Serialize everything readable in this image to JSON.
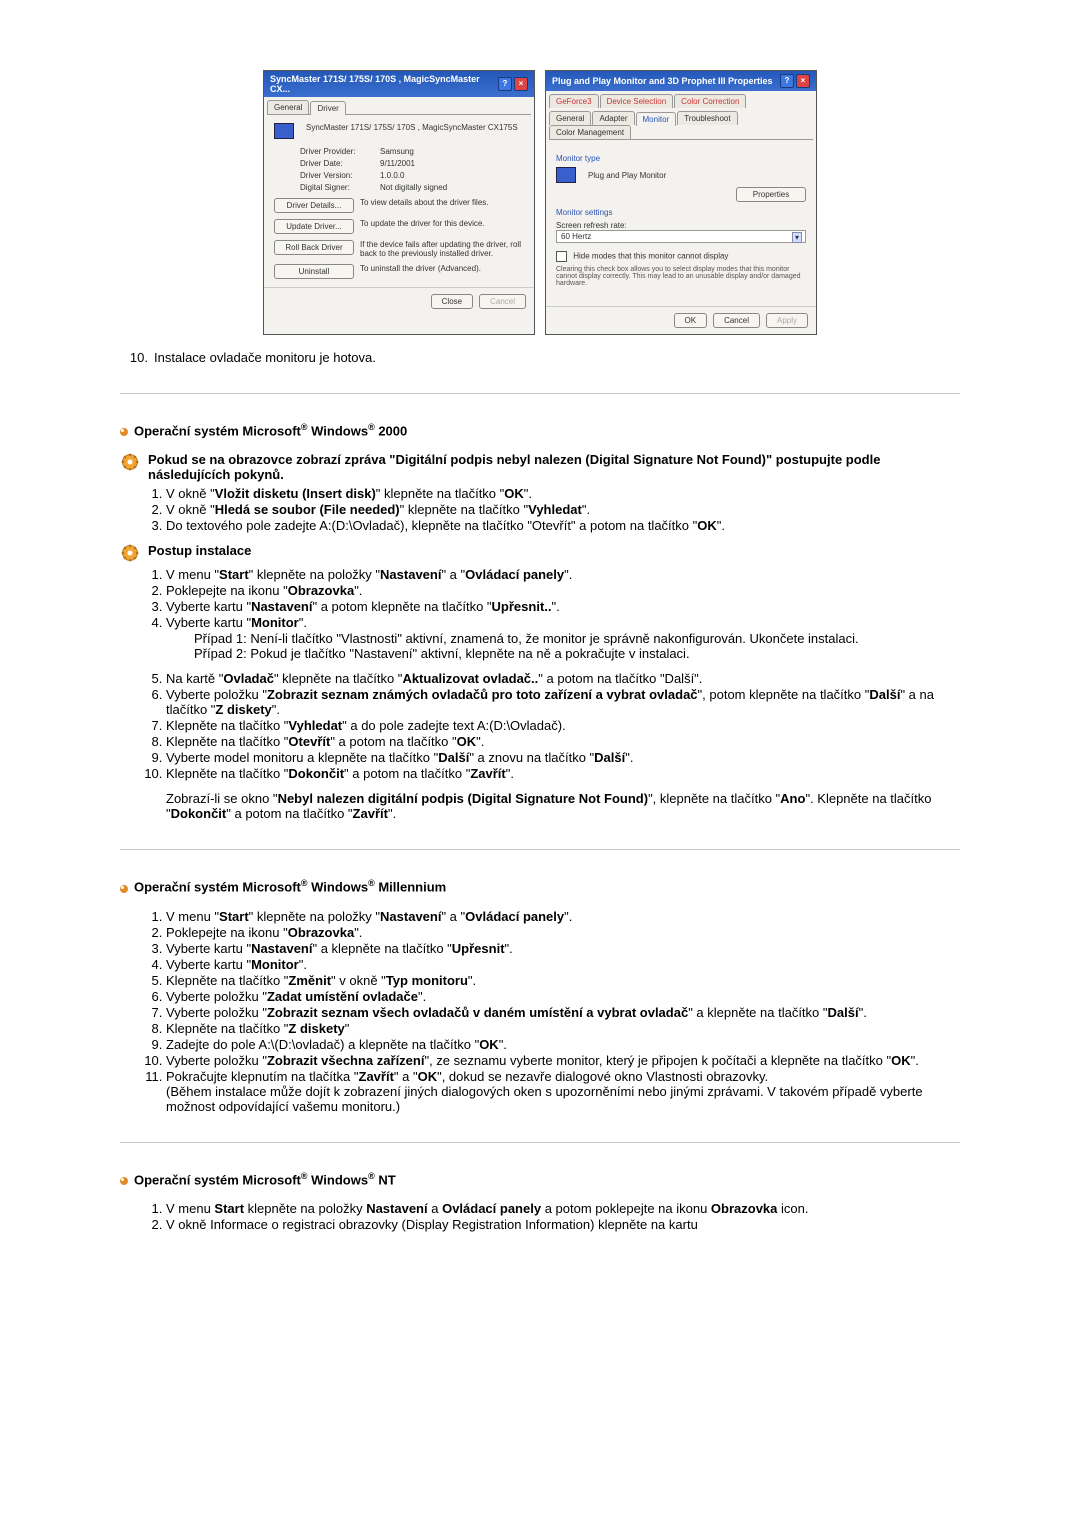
{
  "driverWin": {
    "title": "SyncMaster 171S/ 175S/ 170S , MagicSyncMaster CX...",
    "tabs": {
      "general": "General",
      "driver": "Driver"
    },
    "deviceName": "SyncMaster 171S/ 175S/ 170S , MagicSyncMaster CX175S",
    "rows": {
      "provider": {
        "k": "Driver Provider:",
        "v": "Samsung"
      },
      "date": {
        "k": "Driver Date:",
        "v": "9/11/2001"
      },
      "version": {
        "k": "Driver Version:",
        "v": "1.0.0.0"
      },
      "signer": {
        "k": "Digital Signer:",
        "v": "Not digitally signed"
      }
    },
    "buttons": {
      "details": {
        "label": "Driver Details...",
        "desc": "To view details about the driver files."
      },
      "update": {
        "label": "Update Driver...",
        "desc": "To update the driver for this device."
      },
      "rollback": {
        "label": "Roll Back Driver",
        "desc": "If the device fails after updating the driver, roll back to the previously installed driver."
      },
      "uninstall": {
        "label": "Uninstall",
        "desc": "To uninstall the driver (Advanced)."
      }
    },
    "footer": {
      "close": "Close",
      "cancel": "Cancel"
    }
  },
  "propWin": {
    "title": "Plug and Play Monitor and 3D Prophet III Properties",
    "tabs": {
      "geforce": "GeForce3",
      "device": "Device Selection",
      "color": "Color Correction",
      "general": "General",
      "adapter": "Adapter",
      "monitor": "Monitor",
      "trouble": "Troubleshoot",
      "cmgmt": "Color Management"
    },
    "monitorType": {
      "head": "Monitor type",
      "value": "Plug and Play Monitor",
      "btn": "Properties"
    },
    "settings": {
      "head": "Monitor settings",
      "refreshLabel": "Screen refresh rate:",
      "refreshValue": "60 Hertz",
      "hideModes": "Hide modes that this monitor cannot display",
      "note": "Clearing this check box allows you to select display modes that this monitor cannot display correctly. This may lead to an unusable display and/or damaged hardware."
    },
    "footer": {
      "ok": "OK",
      "cancel": "Cancel",
      "apply": "Apply"
    }
  },
  "afterShots": {
    "n": "10.",
    "t": "Instalace ovladače monitoru je hotova."
  },
  "win2000": {
    "heading": "Operační systém Microsoft<sup>®</sup> Windows<sup>®</sup> 2000",
    "warn1": "Pokud se na obrazovce zobrazí zpráva \"Digitální podpis nebyl nalezen (Digital Signature Not Found)\" postupujte podle následujících pokynů.",
    "warnSteps": [
      "V okně \"<b>Vložit disketu (Insert disk)</b>\" klepněte na tlačítko \"<b>OK</b>\".",
      "V okně \"<b>Hledá se soubor (File needed)</b>\" klepněte na tlačítko \"<b>Vyhledat</b>\".",
      "Do textového pole zadejte A:(D:\\Ovladač), klepněte na tlačítko \"Otevřít\" a potom na tlačítko \"<b>OK</b>\"."
    ],
    "installHead": "Postup instalace",
    "stepsA": [
      "V menu \"<b>Start</b>\" klepněte na položky \"<b>Nastavení</b>\" a \"<b>Ovládací panely</b>\".",
      "Poklepejte na ikonu \"<b>Obrazovka</b>\".",
      "Vyberte kartu \"<b>Nastavení</b>\" a potom klepněte na tlačítko \"<b>Upřesnit..</b>\".",
      "Vyberte kartu \"<b>Monitor</b>\"."
    ],
    "case1": "Případ 1: Není-li tlačítko \"Vlastnosti\" aktivní, znamená to, že monitor je správně nakonfigurován. Ukončete instalaci.",
    "case2": "Případ 2: Pokud je tlačítko \"Nastavení\" aktivní, klepněte na ně a pokračujte v instalaci.",
    "stepsB": [
      "Na kartě \"<b>Ovladač</b>\" klepněte na tlačítko \"<b>Aktualizovat ovladač..</b>\" a potom na tlačítko \"Další\".",
      "Vyberte položku \"<b>Zobrazit seznam známých ovladačů pro toto zařízení a vybrat ovladač</b>\", potom klepněte na tlačítko \"<b>Další</b>\" a na tlačítko \"<b>Z diskety</b>\".",
      "Klepněte na tlačítko \"<b>Vyhledat</b>\" a do pole zadejte text A:(D:\\Ovladač).",
      "Klepněte na tlačítko \"<b>Otevřít</b>\" a potom na tlačítko \"<b>OK</b>\".",
      "Vyberte model monitoru a klepněte na tlačítko \"<b>Další</b>\" a znovu na tlačítko \"<b>Další</b>\".",
      "Klepněte na tlačítko \"<b>Dokončit</b>\" a potom na tlačítko \"<b>Zavřít</b>\"."
    ],
    "tail": "Zobrazí-li se okno \"<b>Nebyl nalezen digitální podpis (Digital Signature Not Found)</b>\", klepněte na tlačítko \"<b>Ano</b>\". Klepněte na tlačítko \"<b>Dokončit</b>\" a potom na tlačítko \"<b>Zavřít</b>\"."
  },
  "winME": {
    "heading": "Operační systém Microsoft<sup>®</sup> Windows<sup>®</sup> Millennium",
    "steps": [
      "V menu \"<b>Start</b>\" klepněte na položky \"<b>Nastavení</b>\" a \"<b>Ovládací panely</b>\".",
      "Poklepejte na ikonu \"<b>Obrazovka</b>\".",
      "Vyberte kartu \"<b>Nastavení</b>\" a klepněte na tlačítko \"<b>Upřesnit</b>\".",
      "Vyberte kartu \"<b>Monitor</b>\".",
      "Klepněte na tlačítko \"<b>Změnit</b>\" v okně \"<b>Typ monitoru</b>\".",
      "Vyberte položku \"<b>Zadat umístění ovladače</b>\".",
      "Vyberte položku \"<b>Zobrazit seznam všech ovladačů v daném umístění a vybrat ovladač</b>\" a klepněte na tlačítko \"<b>Další</b>\".",
      "Klepněte na tlačítko \"<b>Z diskety</b>\"",
      "Zadejte do pole A:\\(D:\\ovladač) a klepněte na tlačítko \"<b>OK</b>\".",
      "Vyberte položku \"<b>Zobrazit všechna zařízení</b>\", ze seznamu vyberte monitor, který je připojen k počítači a klepněte na tlačítko \"<b>OK</b>\".",
      "Pokračujte klepnutím na tlačítka \"<b>Zavřít</b>\" a \"<b>OK</b>\", dokud se nezavře dialogové okno Vlastnosti obrazovky.<br>(Během instalace může dojít k zobrazení jiných dialogových oken s upozorněními nebo jinými zprávami. V takovém případě vyberte možnost odpovídající vašemu monitoru.)"
    ]
  },
  "winNT": {
    "heading": "Operační systém Microsoft<sup>®</sup> Windows<sup>®</sup> NT",
    "steps": [
      "V menu <b>Start</b> klepněte na položky <b>Nastavení</b> a <b>Ovládací panely</b> a potom poklepejte na ikonu <b>Obrazovka</b> icon.",
      "V okně Informace o registraci obrazovky (Display Registration Information) klepněte na kartu"
    ]
  }
}
